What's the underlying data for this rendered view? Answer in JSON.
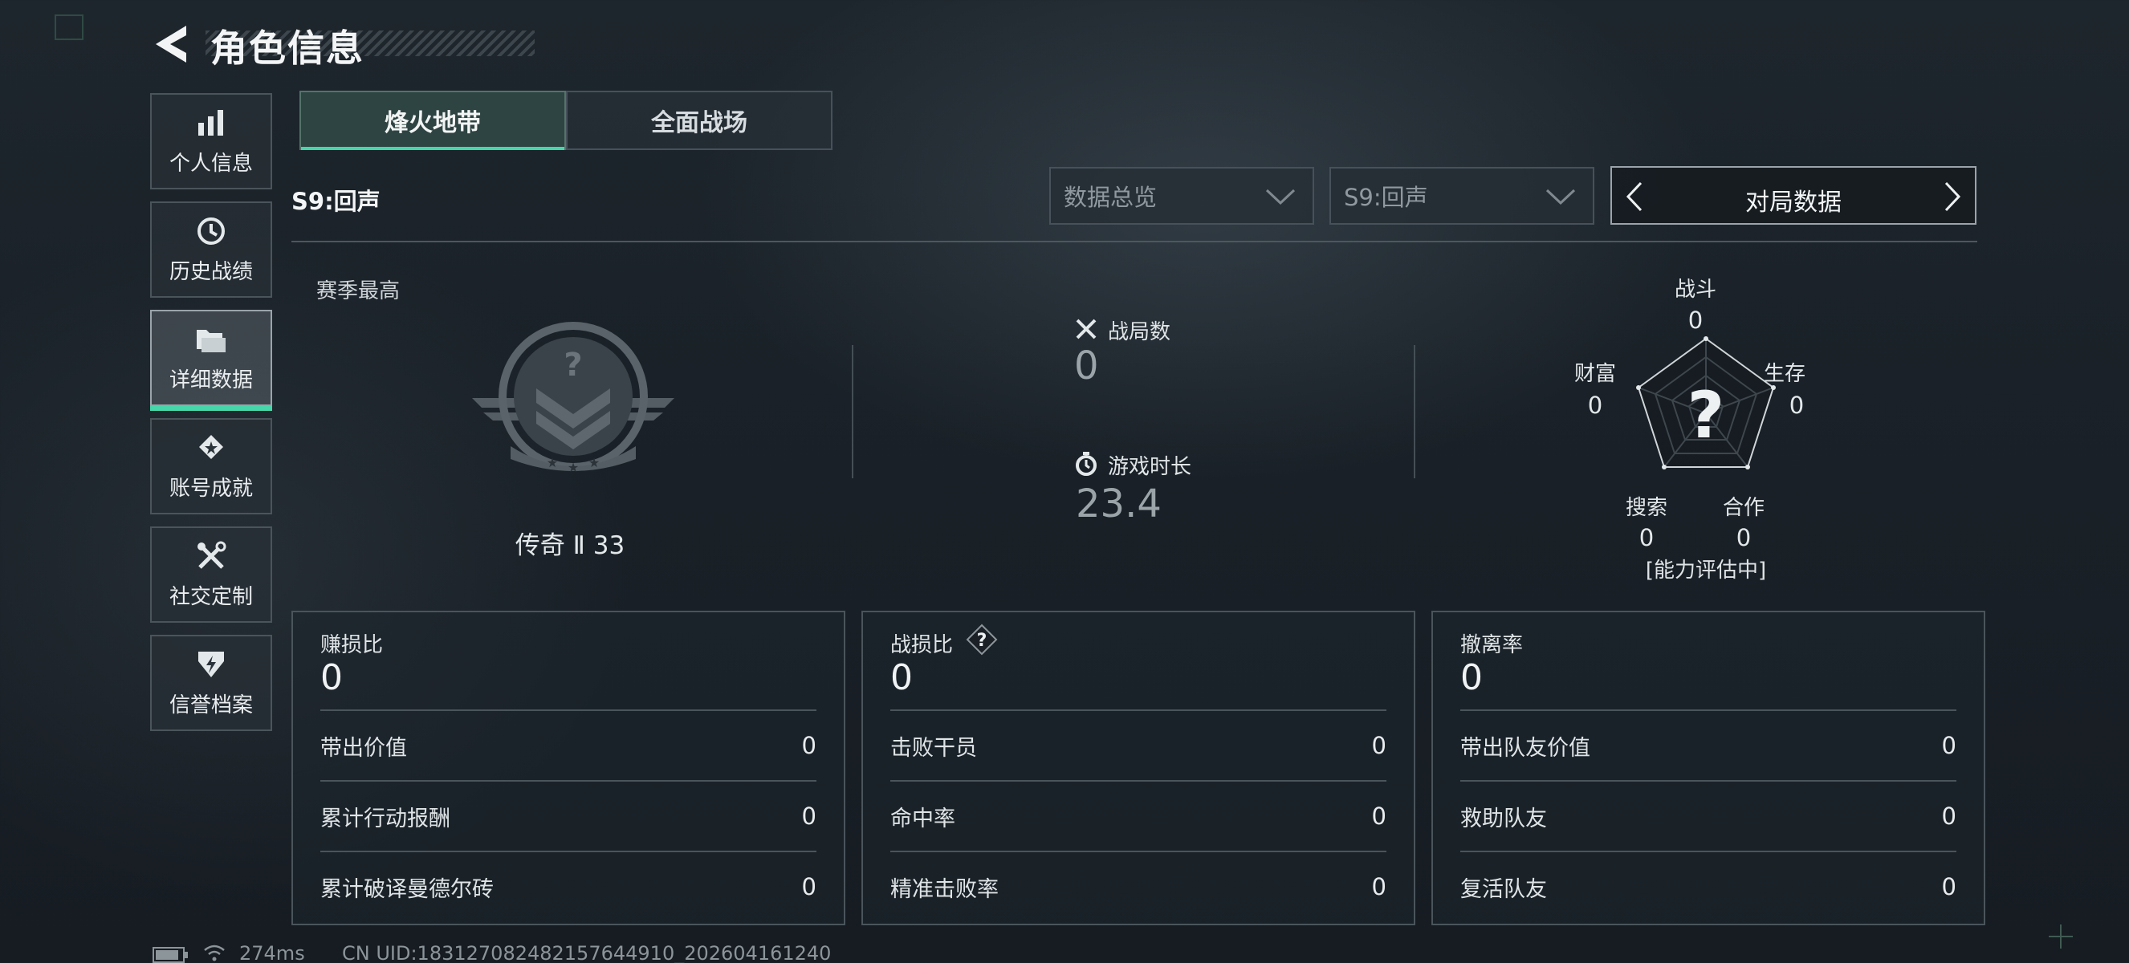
{
  "header": {
    "title": "角色信息"
  },
  "sidebar": {
    "items": [
      {
        "label": "个人信息",
        "icon": "bar-chart-icon"
      },
      {
        "label": "历史战绩",
        "icon": "history-clock-icon"
      },
      {
        "label": "详细数据",
        "icon": "folder-icon",
        "active": true
      },
      {
        "label": "账号成就",
        "icon": "achievement-medal-icon"
      },
      {
        "label": "社交定制",
        "icon": "wrench-screwdriver-icon"
      },
      {
        "label": "信誉档案",
        "icon": "shield-bolt-icon"
      }
    ]
  },
  "mode_tabs": [
    {
      "label": "烽火地带",
      "selected": true
    },
    {
      "label": "全面战场",
      "selected": false
    }
  ],
  "season_label": "S9:回声",
  "filters": {
    "overview_dropdown": "数据总览",
    "season_dropdown": "S9:回声",
    "match_data": "对局数据"
  },
  "overview": {
    "season_best_label": "赛季最高",
    "rank_text": "传奇 Ⅱ 33",
    "battles_label": "战局数",
    "battles_value": "0",
    "playtime_label": "游戏时长",
    "playtime_value": "23.4"
  },
  "radar": {
    "center_mark": "?",
    "axes": [
      {
        "label": "战斗",
        "value": "0"
      },
      {
        "label": "生存",
        "value": "0"
      },
      {
        "label": "合作",
        "value": "0"
      },
      {
        "label": "搜索",
        "value": "0"
      },
      {
        "label": "财富",
        "value": "0"
      }
    ],
    "status": "[能力评估中]"
  },
  "cards": [
    {
      "title": "赚损比",
      "value": "0",
      "rows": [
        {
          "label": "带出价值",
          "value": "0"
        },
        {
          "label": "累计行动报酬",
          "value": "0"
        },
        {
          "label": "累计破译曼德尔砖",
          "value": "0"
        }
      ]
    },
    {
      "title": "战损比",
      "value": "0",
      "help": "?",
      "rows": [
        {
          "label": "击败干员",
          "value": "0"
        },
        {
          "label": "命中率",
          "value": "0"
        },
        {
          "label": "精准击败率",
          "value": "0"
        }
      ]
    },
    {
      "title": "撤离率",
      "value": "0",
      "rows": [
        {
          "label": "带出队友价值",
          "value": "0"
        },
        {
          "label": "救助队友",
          "value": "0"
        },
        {
          "label": "复活队友",
          "value": "0"
        }
      ]
    }
  ],
  "status_bar": {
    "ping": "274ms",
    "uid": "CN UID:183127082482157644910_202604161240"
  },
  "colors": {
    "accent": "#47d6a9",
    "background": "#1b2229",
    "border": "#4a545b"
  }
}
